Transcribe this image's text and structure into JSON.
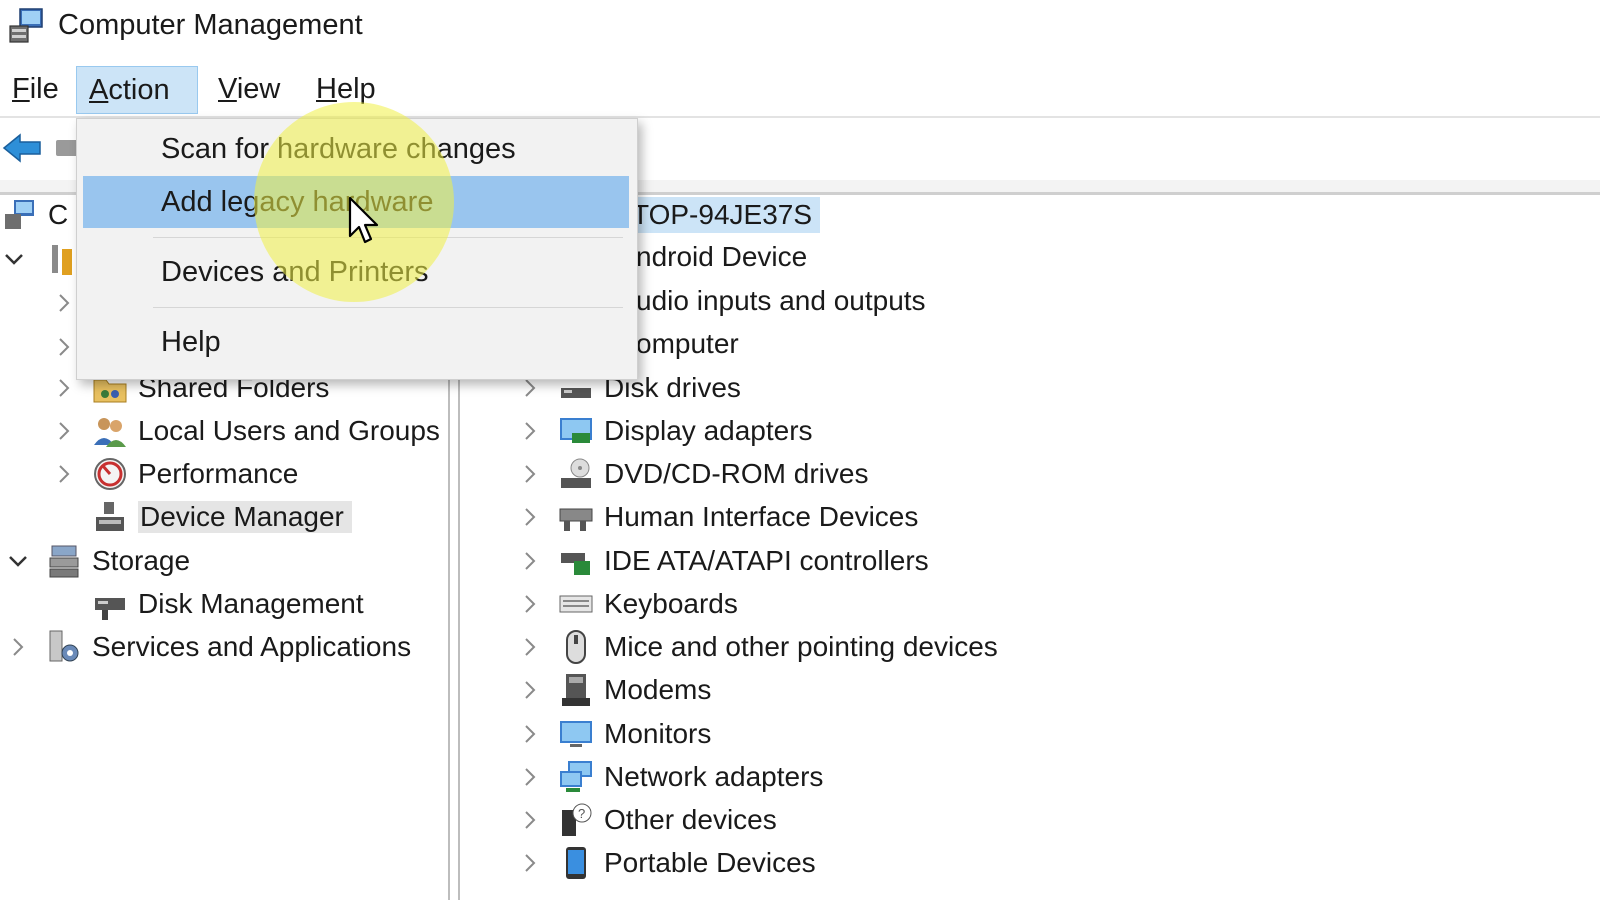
{
  "window": {
    "title": "Computer Management",
    "title_icon": "computer-management-icon"
  },
  "menubar": {
    "items": [
      {
        "label": "File",
        "mnemonic": "F",
        "rest": "ile"
      },
      {
        "label": "Action",
        "mnemonic": "A",
        "rest": "ction",
        "active": true
      },
      {
        "label": "View",
        "mnemonic": "V",
        "rest": "iew"
      },
      {
        "label": "Help",
        "mnemonic": "H",
        "rest": "elp"
      }
    ]
  },
  "action_menu": {
    "items": [
      {
        "label": "Scan for hardware changes"
      },
      {
        "label": "Add legacy hardware",
        "highlighted": true
      },
      {
        "label": "Devices and Printers"
      },
      {
        "label": "Help"
      }
    ]
  },
  "left_tree": {
    "root_partial": "C",
    "items": [
      {
        "label": "Shared Folders",
        "icon": "shared-folders-icon"
      },
      {
        "label": "Local Users and Groups",
        "icon": "users-icon"
      },
      {
        "label": "Performance",
        "icon": "performance-icon"
      },
      {
        "label": "Device Manager",
        "icon": "device-manager-icon",
        "selected": true
      },
      {
        "label": "Storage",
        "icon": "storage-icon",
        "expanded": true
      },
      {
        "label": "Disk Management",
        "icon": "disk-management-icon"
      },
      {
        "label": "Services and Applications",
        "icon": "services-icon"
      }
    ]
  },
  "right_tree": {
    "host": "TOP-94JE37S",
    "partial_categories": [
      "ndroid Device",
      "udio inputs and outputs",
      "omputer"
    ],
    "categories": [
      "Disk drives",
      "Display adapters",
      "DVD/CD-ROM drives",
      "Human Interface Devices",
      "IDE ATA/ATAPI controllers",
      "Keyboards",
      "Mice and other pointing devices",
      "Modems",
      "Monitors",
      "Network adapters",
      "Other devices",
      "Portable Devices"
    ]
  },
  "colors": {
    "menu_active": "#cce4f7",
    "menu_highlight": "#99c5ee",
    "selection": "#e5e5e5"
  }
}
